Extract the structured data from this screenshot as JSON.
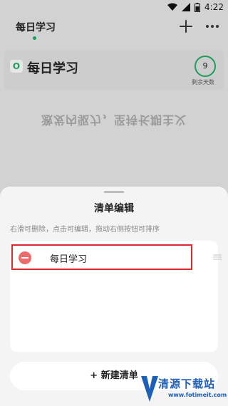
{
  "status_bar": {
    "time": "4:22",
    "icons": [
      "wifi-icon",
      "signal-icon",
      "battery-icon"
    ]
  },
  "app_bar": {
    "tab_label": "每日学习",
    "actions": [
      "plus-icon",
      "more-icon"
    ]
  },
  "list_card": {
    "badge": "O",
    "title": "每日学习",
    "days_count": "9",
    "days_label": "剩余天数"
  },
  "motto": "激发内驱力，坚持长期主义",
  "sheet": {
    "title": "清单编辑",
    "hint": "右滑可删除，点击可编辑，拖动右侧按钮可排序",
    "items": [
      {
        "label": "每日学习",
        "delete_icon": "minus-circle-icon"
      }
    ],
    "drag_icon": "drag-handle-icon",
    "new_button": "+ 新建清单"
  },
  "watermark": {
    "main": "清源下载站",
    "sub": "www.fotimeit.com"
  },
  "colors": {
    "accent": "#1a9e5a",
    "highlight": "#e0282c",
    "delete": "#ef6b6b",
    "watermark": "#1e5fb8"
  }
}
